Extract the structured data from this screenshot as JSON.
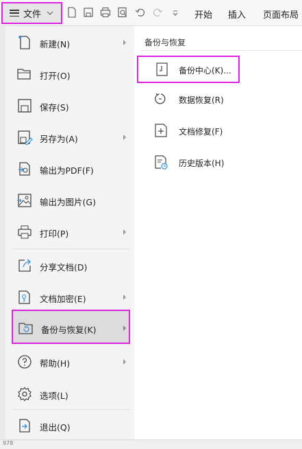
{
  "toolbar": {
    "file_label": "文件",
    "tabs": [
      "开始",
      "插入",
      "页面布局"
    ]
  },
  "menu": {
    "items": [
      {
        "label": "新建(N)",
        "icon": "new-doc-icon",
        "arrow": true
      },
      {
        "label": "打开(O)",
        "icon": "folder-open-icon",
        "arrow": false
      },
      {
        "label": "保存(S)",
        "icon": "save-icon",
        "arrow": false
      },
      {
        "label": "另存为(A)",
        "icon": "save-as-icon",
        "arrow": true
      },
      {
        "label": "输出为PDF(F)",
        "icon": "export-pdf-icon",
        "arrow": false
      },
      {
        "label": "输出为图片(G)",
        "icon": "export-image-icon",
        "arrow": false
      },
      {
        "label": "打印(P)",
        "icon": "print-icon",
        "arrow": true
      },
      {
        "label": "分享文档(D)",
        "icon": "share-icon",
        "arrow": false
      },
      {
        "label": "文档加密(E)",
        "icon": "encrypt-icon",
        "arrow": true
      },
      {
        "label": "备份与恢复(K)",
        "icon": "backup-restore-icon",
        "arrow": true
      },
      {
        "label": "帮助(H)",
        "icon": "help-icon",
        "arrow": true
      },
      {
        "label": "选项(L)",
        "icon": "gear-icon",
        "arrow": false
      },
      {
        "label": "退出(Q)",
        "icon": "exit-icon",
        "arrow": false
      }
    ]
  },
  "submenu": {
    "title": "备份与恢复",
    "items": [
      {
        "label": "备份中心(K)...",
        "icon": "backup-center-icon"
      },
      {
        "label": "数据恢复(R)",
        "icon": "data-restore-icon"
      },
      {
        "label": "文档修复(F)",
        "icon": "doc-repair-icon"
      },
      {
        "label": "历史版本(H)",
        "icon": "history-version-icon"
      }
    ]
  },
  "sheet": {
    "corner_text": "978"
  },
  "colors": {
    "highlight": "#e020e0",
    "active_bg": "#dcdcdc"
  }
}
